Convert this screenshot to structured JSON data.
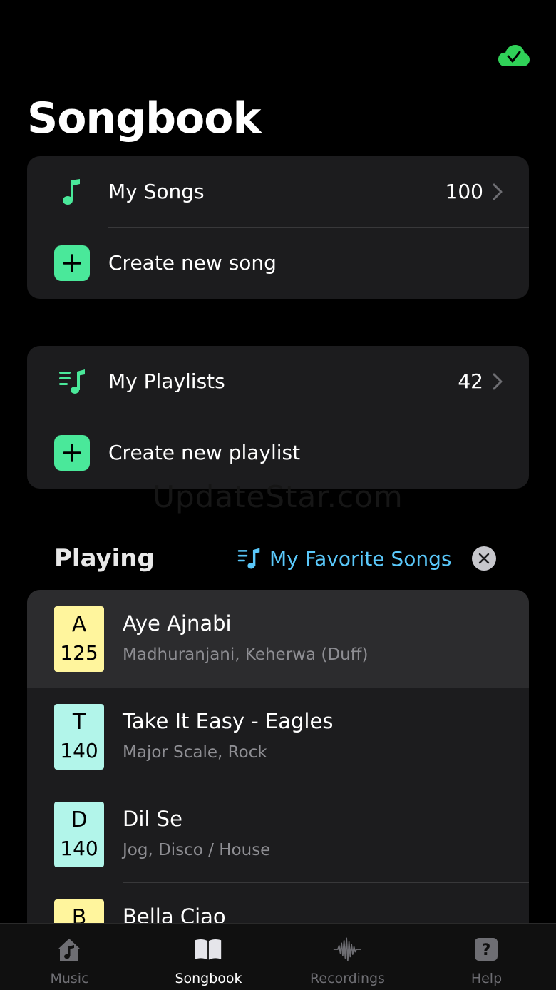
{
  "header": {
    "title": "Songbook",
    "sync_status_icon": "cloud-check-icon",
    "sync_color": "#30d158"
  },
  "songs_card": {
    "label": "My Songs",
    "count": "100",
    "create_label": "Create new song"
  },
  "playlists_card": {
    "label": "My Playlists",
    "count": "42",
    "create_label": "Create new playlist"
  },
  "watermark": "UpdateStar.com",
  "playing": {
    "label": "Playing",
    "playlist_name": "My Favorite Songs"
  },
  "songs": [
    {
      "letter": "A",
      "tempo": "125",
      "title": "Aye Ajnabi",
      "subtitle": "Madhuranjani, Keherwa (Duff)",
      "color": "#fff59d"
    },
    {
      "letter": "T",
      "tempo": "140",
      "title": "Take It Easy - Eagles",
      "subtitle": "Major Scale, Rock",
      "color": "#b2f5ea"
    },
    {
      "letter": "D",
      "tempo": "140",
      "title": "Dil Se",
      "subtitle": "Jog, Disco / House",
      "color": "#b2f5ea"
    },
    {
      "letter": "B",
      "tempo": "",
      "title": "Bella Ciao",
      "subtitle": "",
      "color": "#fff59d"
    }
  ],
  "tabs": [
    {
      "label": "Music",
      "icon": "music-house-icon"
    },
    {
      "label": "Songbook",
      "icon": "book-icon"
    },
    {
      "label": "Recordings",
      "icon": "waveform-icon"
    },
    {
      "label": "Help",
      "icon": "question-icon"
    }
  ],
  "colors": {
    "accent_green": "#4ae89a",
    "accent_blue": "#5ac8fa",
    "background": "#000000",
    "card": "#1c1c1e"
  }
}
